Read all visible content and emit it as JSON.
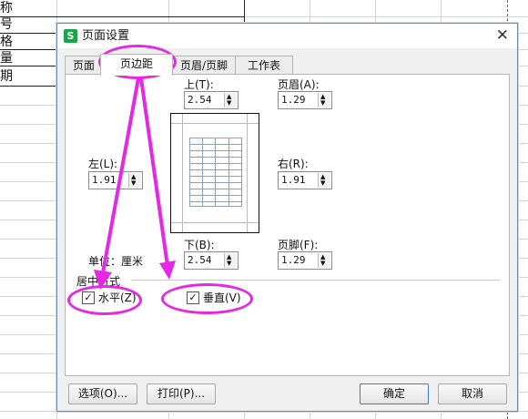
{
  "sheet": {
    "cells": [
      "称",
      "号",
      "格",
      "量",
      "期"
    ]
  },
  "dialog": {
    "app_icon": "S",
    "title": "页面设置",
    "close_glyph": "✕",
    "tabs": [
      "页面",
      "页边距",
      "页眉/页脚",
      "工作表"
    ],
    "active_tab": "页边距",
    "fields": {
      "top": {
        "label": "上(T):",
        "value": "2.54"
      },
      "header": {
        "label": "页眉(A):",
        "value": "1.29"
      },
      "left": {
        "label": "左(L):",
        "value": "1.91"
      },
      "right": {
        "label": "右(R):",
        "value": "1.91"
      },
      "bottom": {
        "label": "下(B):",
        "value": "2.54"
      },
      "footer": {
        "label": "页脚(F):",
        "value": "1.29"
      }
    },
    "unit_label": "单位：厘米",
    "center_group_title": "居中方式",
    "horizontal": {
      "label": "水平(Z)",
      "checked": true
    },
    "vertical": {
      "label": "垂直(V)",
      "checked": true
    },
    "buttons": {
      "options": "选项(O)...",
      "print": "打印(P)...",
      "ok": "确定",
      "cancel": "取消"
    }
  },
  "annotation_color": "#e428e4",
  "icons": {
    "spin_up": "▲",
    "spin_down": "▼",
    "check": "✓"
  }
}
